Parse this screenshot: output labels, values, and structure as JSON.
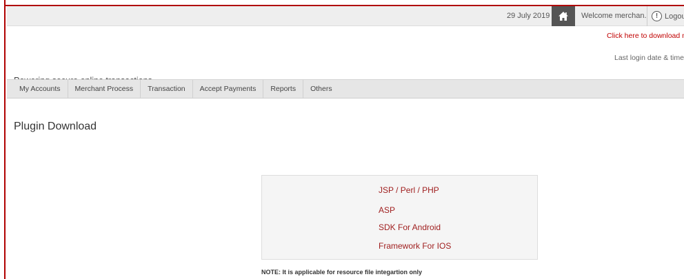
{
  "topbar": {
    "date": "29 July 2019",
    "home_icon": "home-icon",
    "welcome": "Welcome merchan...",
    "logout_label": "Logout",
    "user_icon": "user-circle-icon"
  },
  "header": {
    "download_link": "Click here to download m",
    "last_login_label": "Last login date & time:",
    "tagline": "Powering secure online transactions"
  },
  "nav": {
    "items": [
      {
        "label": "My Accounts"
      },
      {
        "label": "Merchant Process"
      },
      {
        "label": "Transaction"
      },
      {
        "label": "Accept Payments"
      },
      {
        "label": "Reports"
      },
      {
        "label": "Others"
      }
    ]
  },
  "main": {
    "title": "Plugin Download",
    "plugins": [
      {
        "label": "JSP / Perl / PHP"
      },
      {
        "label": "ASP"
      },
      {
        "label": "SDK For Android"
      },
      {
        "label": "Framework For IOS"
      }
    ],
    "note": "NOTE: It is applicable for resource file integartion only"
  },
  "colors": {
    "accent_red": "#b00000",
    "link_red": "#a02020",
    "nav_bg": "#e6e6e6",
    "topbar_bg": "#eeeeee"
  }
}
